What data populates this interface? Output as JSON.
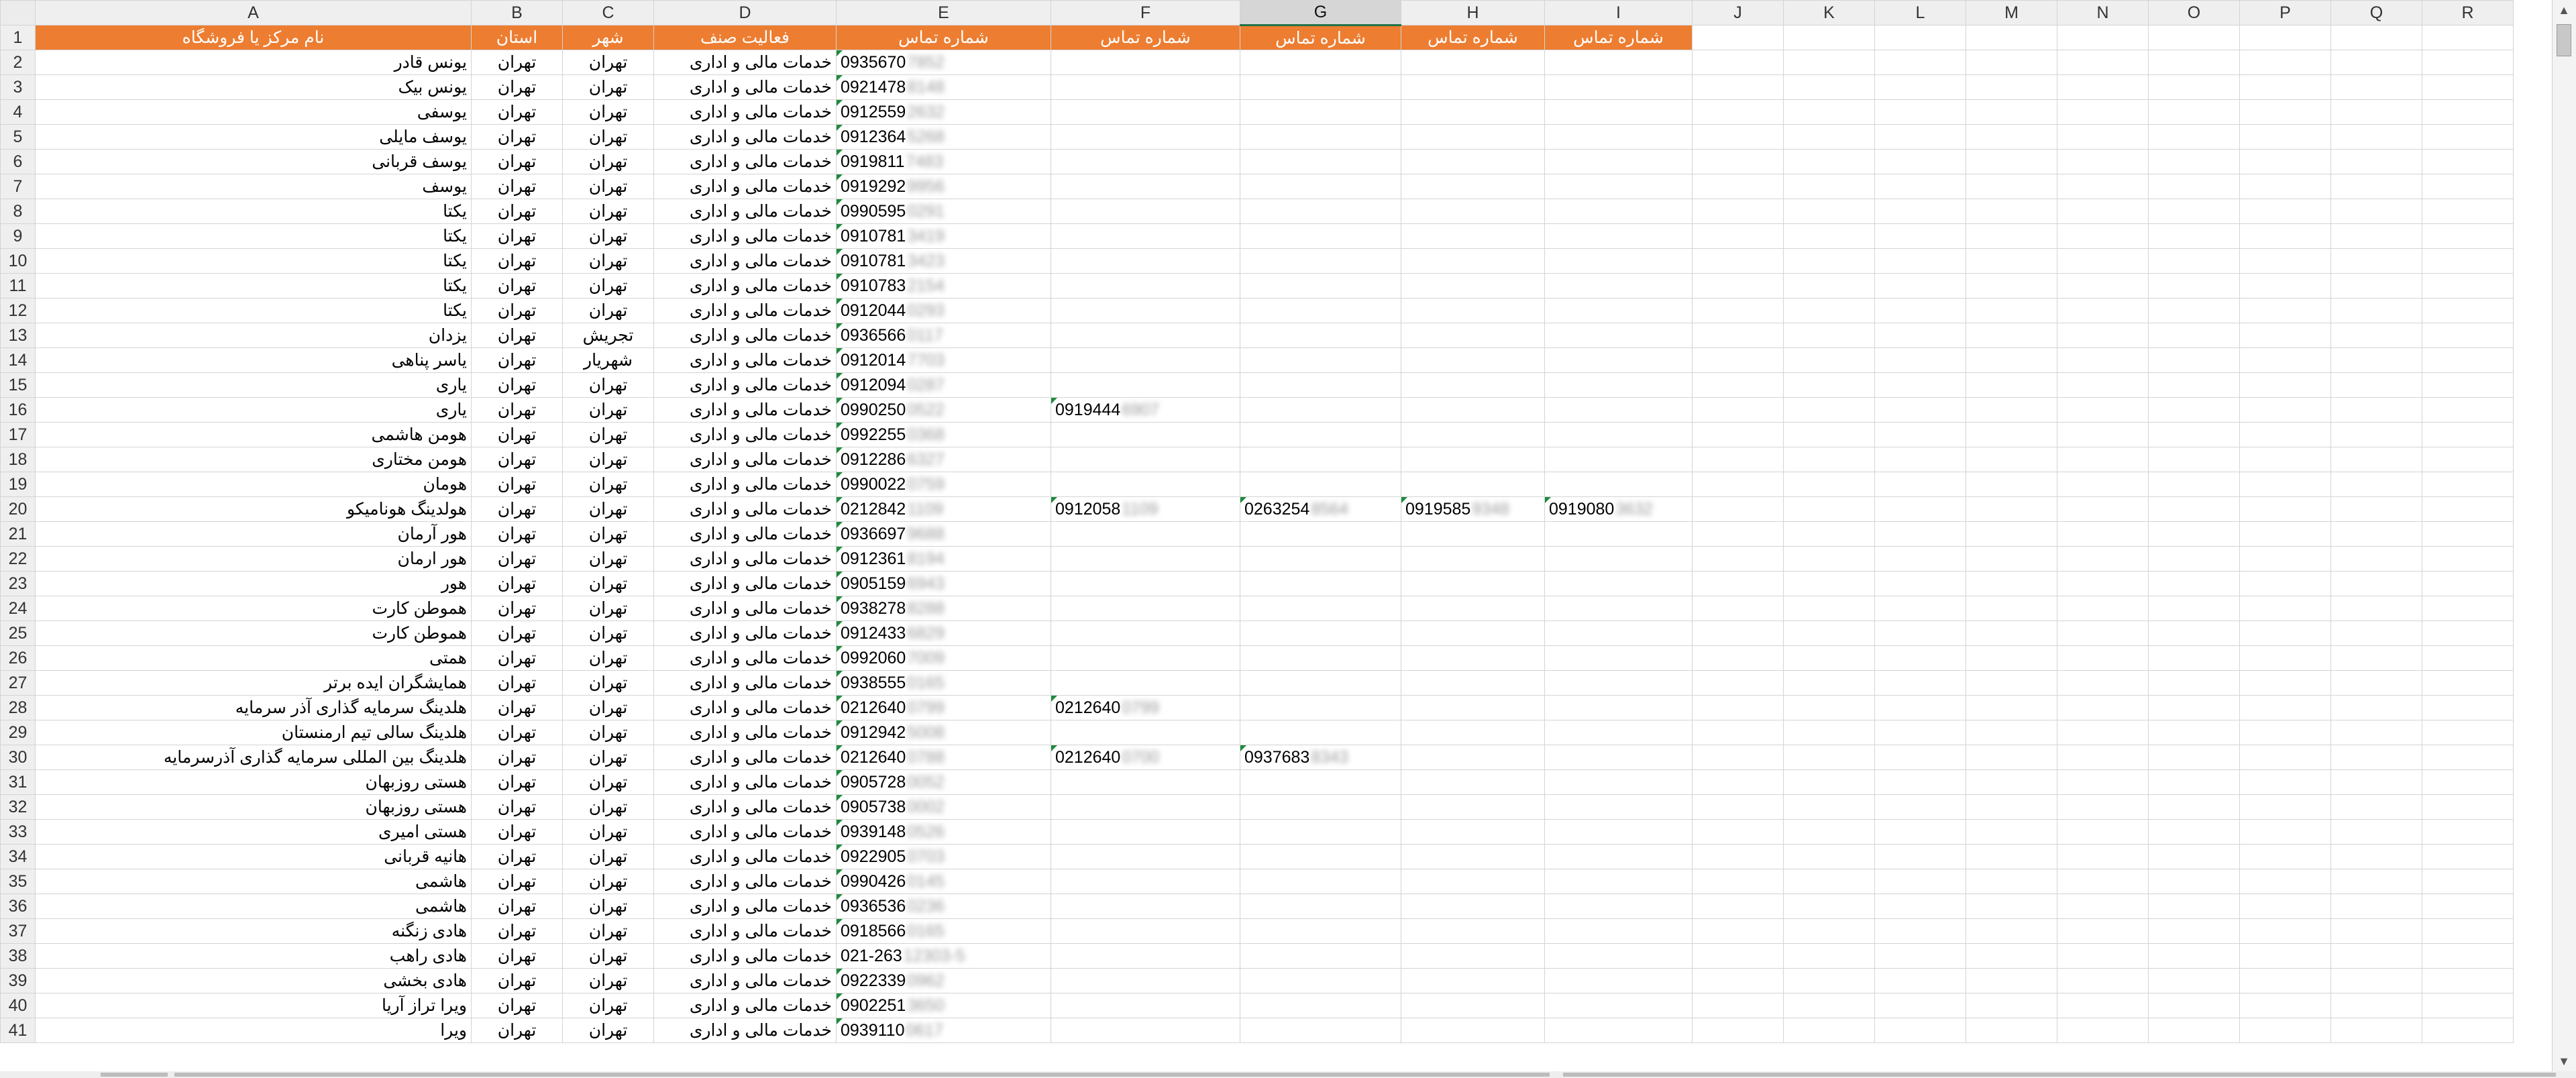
{
  "columns": {
    "letters": [
      "A",
      "B",
      "C",
      "D",
      "E",
      "F",
      "G",
      "H",
      "I",
      "J",
      "K",
      "L",
      "M",
      "N",
      "O",
      "P",
      "Q",
      "R"
    ],
    "selected": "G"
  },
  "header_row": {
    "row": "1",
    "cells": [
      "نام مرکز یا فروشگاه",
      "استان",
      "شهر",
      "فعالیت صنف",
      "شماره تماس",
      "شماره تماس",
      "شماره تماس",
      "شماره تماس",
      "شماره تماس"
    ]
  },
  "rows": [
    {
      "n": "2",
      "name": "یونس قادر",
      "prov": "تهران",
      "city": "تهران",
      "act": "خدمات مالی و اداری",
      "e": [
        "0935670",
        "7852"
      ]
    },
    {
      "n": "3",
      "name": "یونس بیک",
      "prov": "تهران",
      "city": "تهران",
      "act": "خدمات مالی و اداری",
      "e": [
        "0921478",
        "8148"
      ]
    },
    {
      "n": "4",
      "name": "یوسفی",
      "prov": "تهران",
      "city": "تهران",
      "act": "خدمات مالی و اداری",
      "e": [
        "0912559",
        "2632"
      ]
    },
    {
      "n": "5",
      "name": "یوسف مایلی",
      "prov": "تهران",
      "city": "تهران",
      "act": "خدمات مالی و اداری",
      "e": [
        "0912364",
        "5268"
      ]
    },
    {
      "n": "6",
      "name": "یوسف قربانی",
      "prov": "تهران",
      "city": "تهران",
      "act": "خدمات مالی و اداری",
      "e": [
        "0919811",
        "7483"
      ]
    },
    {
      "n": "7",
      "name": "یوسف",
      "prov": "تهران",
      "city": "تهران",
      "act": "خدمات مالی و اداری",
      "e": [
        "0919292",
        "9956"
      ]
    },
    {
      "n": "8",
      "name": "یکتا",
      "prov": "تهران",
      "city": "تهران",
      "act": "خدمات مالی و اداری",
      "e": [
        "0990595",
        "0291"
      ]
    },
    {
      "n": "9",
      "name": "یکتا",
      "prov": "تهران",
      "city": "تهران",
      "act": "خدمات مالی و اداری",
      "e": [
        "0910781",
        "3419"
      ]
    },
    {
      "n": "10",
      "name": "یکتا",
      "prov": "تهران",
      "city": "تهران",
      "act": "خدمات مالی و اداری",
      "e": [
        "0910781",
        "3423"
      ]
    },
    {
      "n": "11",
      "name": "یکتا",
      "prov": "تهران",
      "city": "تهران",
      "act": "خدمات مالی و اداری",
      "e": [
        "0910783",
        "2154"
      ]
    },
    {
      "n": "12",
      "name": "یکتا",
      "prov": "تهران",
      "city": "تهران",
      "act": "خدمات مالی و اداری",
      "e": [
        "0912044",
        "0293"
      ]
    },
    {
      "n": "13",
      "name": "یزدان",
      "prov": "تهران",
      "city": "تجریش",
      "act": "خدمات مالی و اداری",
      "e": [
        "0936566",
        "0117"
      ]
    },
    {
      "n": "14",
      "name": "یاسر پناهی",
      "prov": "تهران",
      "city": "شهریار",
      "act": "خدمات مالی و اداری",
      "e": [
        "0912014",
        "7703"
      ]
    },
    {
      "n": "15",
      "name": "یاری",
      "prov": "تهران",
      "city": "تهران",
      "act": "خدمات مالی و اداری",
      "e": [
        "0912094",
        "0287"
      ]
    },
    {
      "n": "16",
      "name": "یاری",
      "prov": "تهران",
      "city": "تهران",
      "act": "خدمات مالی و اداری",
      "e": [
        "0990250",
        "0522"
      ],
      "f": [
        "0919444",
        "6907"
      ]
    },
    {
      "n": "17",
      "name": "هومن هاشمی",
      "prov": "تهران",
      "city": "تهران",
      "act": "خدمات مالی و اداری",
      "e": [
        "0992255",
        "0368"
      ]
    },
    {
      "n": "18",
      "name": "هومن مختاری",
      "prov": "تهران",
      "city": "تهران",
      "act": "خدمات مالی و اداری",
      "e": [
        "0912286",
        "6327"
      ]
    },
    {
      "n": "19",
      "name": "هومان",
      "prov": "تهران",
      "city": "تهران",
      "act": "خدمات مالی و اداری",
      "e": [
        "0990022",
        "0759"
      ]
    },
    {
      "n": "20",
      "name": "هولدینگ هونامیکو",
      "prov": "تهران",
      "city": "تهران",
      "act": "خدمات مالی و اداری",
      "e": [
        "0212842",
        "1109"
      ],
      "f": [
        "0912058",
        "1109"
      ],
      "g": [
        "0263254",
        "8564"
      ],
      "h": [
        "0919585",
        "9348"
      ],
      "i": [
        "0919080",
        "3632"
      ]
    },
    {
      "n": "21",
      "name": "هور آرمان",
      "prov": "تهران",
      "city": "تهران",
      "act": "خدمات مالی و اداری",
      "e": [
        "0936697",
        "9688"
      ]
    },
    {
      "n": "22",
      "name": "هور ارمان",
      "prov": "تهران",
      "city": "تهران",
      "act": "خدمات مالی و اداری",
      "e": [
        "0912361",
        "8194"
      ]
    },
    {
      "n": "23",
      "name": "هور",
      "prov": "تهران",
      "city": "تهران",
      "act": "خدمات مالی و اداری",
      "e": [
        "0905159",
        "6943"
      ]
    },
    {
      "n": "24",
      "name": "هموطن کارت",
      "prov": "تهران",
      "city": "تهران",
      "act": "خدمات مالی و اداری",
      "e": [
        "0938278",
        "8288"
      ]
    },
    {
      "n": "25",
      "name": "هموطن کارت",
      "prov": "تهران",
      "city": "تهران",
      "act": "خدمات مالی و اداری",
      "e": [
        "0912433",
        "6829"
      ]
    },
    {
      "n": "26",
      "name": "همتی",
      "prov": "تهران",
      "city": "تهران",
      "act": "خدمات مالی و اداری",
      "e": [
        "0992060",
        "7009"
      ]
    },
    {
      "n": "27",
      "name": "همایشگران ایده برتر",
      "prov": "تهران",
      "city": "تهران",
      "act": "خدمات مالی و اداری",
      "e": [
        "0938555",
        "0165"
      ]
    },
    {
      "n": "28",
      "name": "هلدینگ سرمایه گذاری آذر سرمایه",
      "prov": "تهران",
      "city": "تهران",
      "act": "خدمات مالی و اداری",
      "e": [
        "0212640",
        "0799"
      ],
      "f": [
        "0212640",
        "0799"
      ]
    },
    {
      "n": "29",
      "name": "هلدینگ سالی تیم ارمنستان",
      "prov": "تهران",
      "city": "تهران",
      "act": "خدمات مالی و اداری",
      "e": [
        "0912942",
        "5008"
      ]
    },
    {
      "n": "30",
      "name": "هلدینگ بین المللی سرمایه گذاری آذرسرمایه",
      "prov": "تهران",
      "city": "تهران",
      "act": "خدمات مالی و اداری",
      "e": [
        "0212640",
        "0788"
      ],
      "f": [
        "0212640",
        "0700"
      ],
      "g": [
        "0937683",
        "8343"
      ]
    },
    {
      "n": "31",
      "name": "هستی روزبهان",
      "prov": "تهران",
      "city": "تهران",
      "act": "خدمات مالی و اداری",
      "e": [
        "0905728",
        "0052"
      ]
    },
    {
      "n": "32",
      "name": "هستی روزبهان",
      "prov": "تهران",
      "city": "تهران",
      "act": "خدمات مالی و اداری",
      "e": [
        "0905738",
        "0002"
      ]
    },
    {
      "n": "33",
      "name": "هستی امیری",
      "prov": "تهران",
      "city": "تهران",
      "act": "خدمات مالی و اداری",
      "e": [
        "0939148",
        "0526"
      ]
    },
    {
      "n": "34",
      "name": "هانیه قربانی",
      "prov": "تهران",
      "city": "تهران",
      "act": "خدمات مالی و اداری",
      "e": [
        "0922905",
        "0703"
      ]
    },
    {
      "n": "35",
      "name": "هاشمی",
      "prov": "تهران",
      "city": "تهران",
      "act": "خدمات مالی و اداری",
      "e": [
        "0990426",
        "0145"
      ]
    },
    {
      "n": "36",
      "name": "هاشمی",
      "prov": "تهران",
      "city": "تهران",
      "act": "خدمات مالی و اداری",
      "e": [
        "0936536",
        "0236"
      ]
    },
    {
      "n": "37",
      "name": "هادی زنگنه",
      "prov": "تهران",
      "city": "تهران",
      "act": "خدمات مالی و اداری",
      "e": [
        "0918566",
        "0165"
      ]
    },
    {
      "n": "38",
      "name": "هادی راهب",
      "prov": "تهران",
      "city": "تهران",
      "act": "خدمات مالی و اداری",
      "e": [
        "021-263",
        "12303-5"
      ],
      "noflag": true
    },
    {
      "n": "39",
      "name": "هادی بخشی",
      "prov": "تهران",
      "city": "تهران",
      "act": "خدمات مالی و اداری",
      "e": [
        "0922339",
        "0962"
      ]
    },
    {
      "n": "40",
      "name": "ویرا تراز آریا",
      "prov": "تهران",
      "city": "تهران",
      "act": "خدمات مالی و اداری",
      "e": [
        "0902251",
        "3650"
      ]
    },
    {
      "n": "41",
      "name": "ویرا",
      "prov": "تهران",
      "city": "تهران",
      "act": "خدمات مالی و اداری",
      "e": [
        "0939110",
        "0617"
      ]
    }
  ]
}
